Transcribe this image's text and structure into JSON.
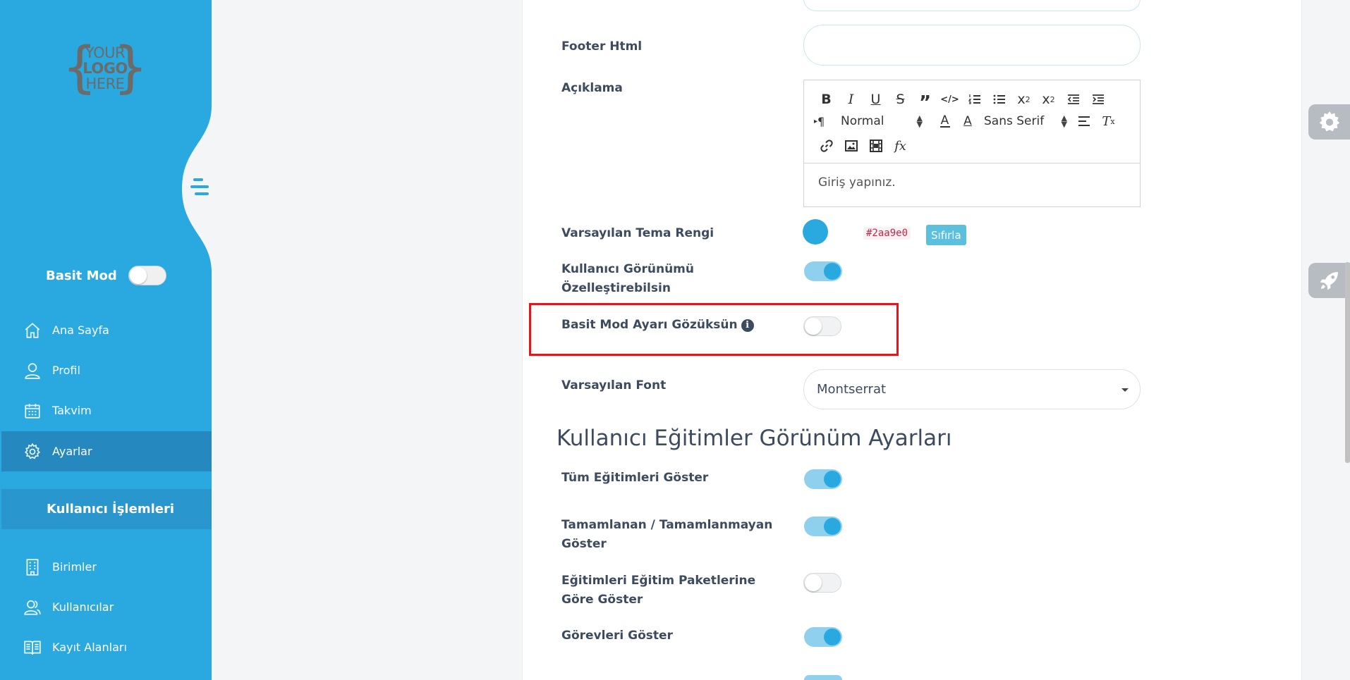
{
  "logo": {
    "line1": "YOUR",
    "line2": "LOGO",
    "line3": "HERE",
    "brace_left": "{",
    "brace_right": "}"
  },
  "sidebar": {
    "basit_mod_label": "Basit Mod",
    "basit_mod_enabled": false,
    "items": [
      {
        "label": "Ana Sayfa",
        "icon": "home-icon"
      },
      {
        "label": "Profil",
        "icon": "user-icon"
      },
      {
        "label": "Takvim",
        "icon": "calendar-icon"
      },
      {
        "label": "Ayarlar",
        "icon": "gear-icon",
        "active": true
      }
    ],
    "section_title": "Kullanıcı İşlemleri",
    "section_items": [
      {
        "label": "Birimler",
        "icon": "building-icon"
      },
      {
        "label": "Kullanıcılar",
        "icon": "users-icon"
      },
      {
        "label": "Kayıt Alanları",
        "icon": "book-icon"
      }
    ],
    "color": "#2aa9e0"
  },
  "form": {
    "footer_html": {
      "label": "Footer Html",
      "value": ""
    },
    "aciklama": {
      "label": "Açıklama",
      "toolbar": {
        "bold": "B",
        "italic": "I",
        "underline": "U",
        "strike": "S",
        "quote": "”",
        "code": "</>",
        "subscript": "x",
        "subscript_mark": "2",
        "superscript": "x",
        "superscript_mark": "2",
        "paragraph": "¶",
        "paragraph_arrow": "▸",
        "size_value": "Normal",
        "font_value": "Sans Serif",
        "color": "A",
        "bg": "A",
        "formula": "fx",
        "clean": "T",
        "clean_mark": "x"
      },
      "placeholder": "Giriş yapınız."
    },
    "tema_rengi": {
      "label": "Varsayılan Tema Rengi",
      "hex": "#2aa9e0",
      "reset_label": "Sıfırla"
    },
    "kullanici_gorunumu": {
      "label_line1": "Kullanıcı Görünümü",
      "label_line2": "Özelleştirebilsin",
      "enabled": true
    },
    "basit_mod_ayari": {
      "label": "Basit Mod Ayarı Gözüksün",
      "info": "i",
      "enabled": false
    },
    "varsayilan_font": {
      "label": "Varsayılan Font",
      "value": "Montserrat"
    }
  },
  "egitimler": {
    "title": "Kullanıcı Eğitimler Görünüm Ayarları",
    "rows": [
      {
        "label_line1": "Tüm Eğitimleri Göster",
        "label_line2": "",
        "enabled": true
      },
      {
        "label_line1": "Tamamlanan / Tamamlanmayan",
        "label_line2": "Göster",
        "enabled": true
      },
      {
        "label_line1": "Eğitimleri Eğitim Paketlerine",
        "label_line2": "Göre Göster",
        "enabled": false
      },
      {
        "label_line1": "Görevleri Göster",
        "label_line2": "",
        "enabled": true
      }
    ]
  },
  "float_buttons": [
    {
      "icon": "gear-icon"
    },
    {
      "icon": "rocket-icon"
    }
  ],
  "highlight_color": "#e8141a"
}
